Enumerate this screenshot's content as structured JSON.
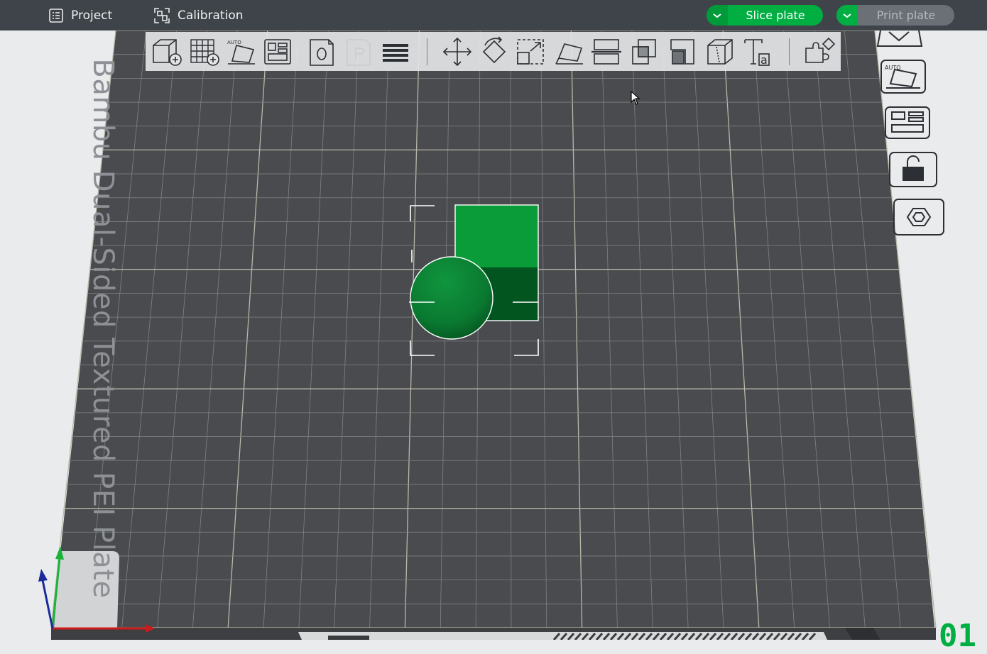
{
  "topbar": {
    "project_label": "Project",
    "calibration_label": "Calibration",
    "slice_label": "Slice plate",
    "print_label": "Print plate"
  },
  "toolbar": {
    "tools": [
      {
        "name": "add-object-icon"
      },
      {
        "name": "add-plate-icon"
      },
      {
        "name": "auto-orient-icon",
        "text": "AUTO"
      },
      {
        "name": "arrange-icon"
      },
      {
        "name": "split-objects-icon",
        "text": "O"
      },
      {
        "name": "split-parts-icon",
        "text": "P"
      },
      {
        "name": "layers-icon"
      },
      {
        "name": "move-icon"
      },
      {
        "name": "rotate-icon"
      },
      {
        "name": "scale-icon"
      },
      {
        "name": "lay-on-face-icon"
      },
      {
        "name": "cut-icon"
      },
      {
        "name": "boolean-icon"
      },
      {
        "name": "support-paint-icon"
      },
      {
        "name": "seam-paint-icon"
      },
      {
        "name": "text-tool-icon",
        "text": "Ta"
      },
      {
        "name": "assembly-icon"
      }
    ]
  },
  "right_panel": {
    "buttons": [
      "close-view-icon",
      "auto-orient-icon",
      "arrange-icon",
      "lock-icon",
      "settings-hex-icon"
    ],
    "auto_text": "AUTO"
  },
  "plate": {
    "label": "Bambu Dual-Sided Textured PEI Plate",
    "number": "01"
  },
  "colors": {
    "accent": "#00ae42",
    "bed": "#4a4b4f",
    "grid": "#8a8c8e",
    "topbar": "#3e4449"
  }
}
